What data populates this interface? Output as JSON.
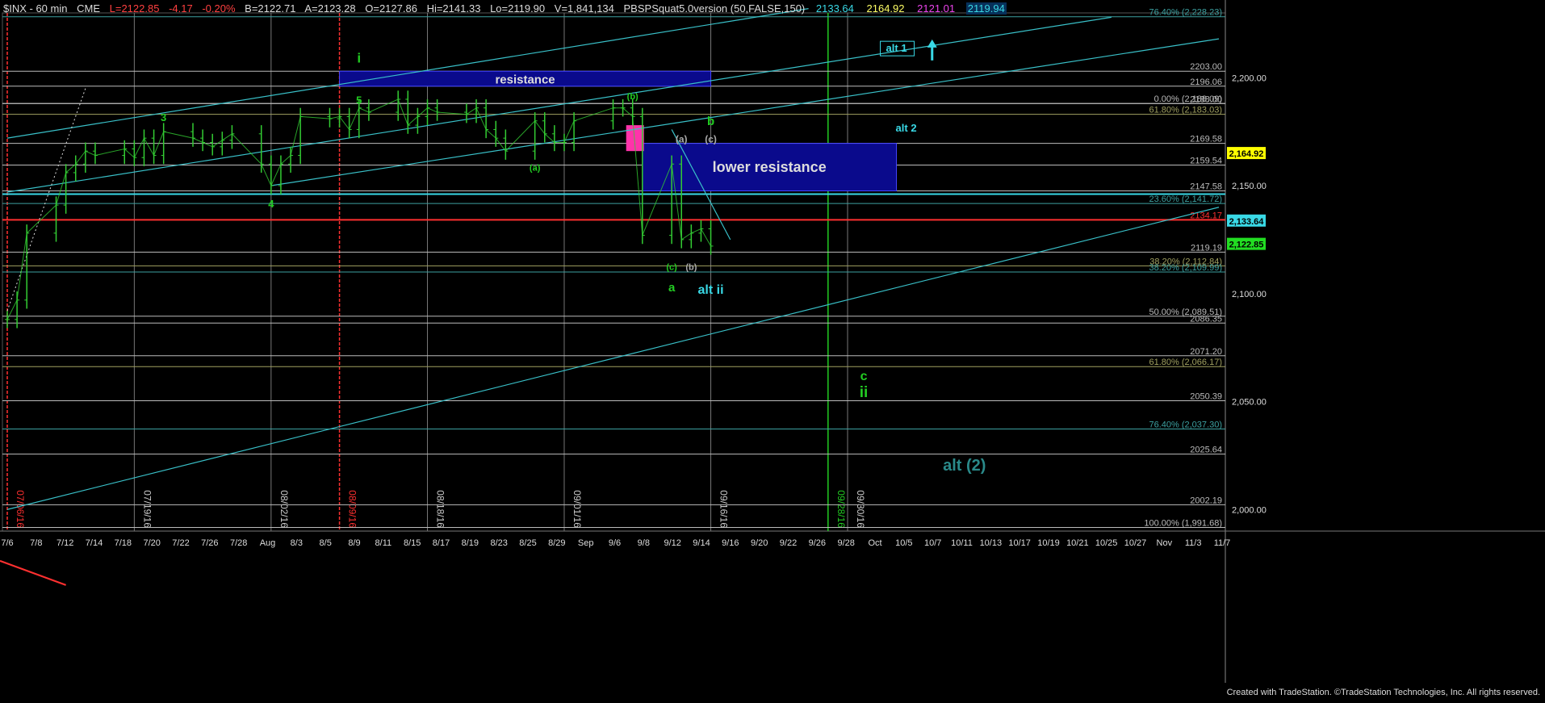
{
  "header": {
    "symbol": "$INX - 60 min",
    "exchange": "CME",
    "last": "L=2122.85",
    "change": "-4.17",
    "change_pct": "-0.20%",
    "bid": "B=2122.71",
    "ask": "A=2123.28",
    "open": "O=2127.86",
    "high": "Hi=2141.33",
    "low": "Lo=2119.90",
    "volume": "V=1,841,134",
    "study": "PBSPSquat5.0version (50,FALSE,150)",
    "study_values": [
      {
        "text": "2133.64",
        "color": "#39d9e6"
      },
      {
        "text": "2164.92",
        "color": "#ffff66"
      },
      {
        "text": "2121.01",
        "color": "#ee44ee"
      },
      {
        "text": "2119.94",
        "color": "#39d9e6"
      }
    ]
  },
  "footer": "Created with TradeStation. ©TradeStation Technologies, Inc. All rights reserved.",
  "chart_data": {
    "type": "line",
    "title": "",
    "ylim": [
      1990,
      2230
    ],
    "y_axis_ticks": [
      "2,200.00",
      "2,150.00",
      "2,100.00",
      "2,050.00",
      "2,000.00"
    ],
    "x_axis_labels": [
      "7/6",
      "7/8",
      "7/12",
      "7/14",
      "7/18",
      "7/20",
      "7/22",
      "7/26",
      "7/28",
      "Aug",
      "8/3",
      "8/5",
      "8/9",
      "8/11",
      "8/15",
      "8/17",
      "8/19",
      "8/23",
      "8/25",
      "8/29",
      "Sep",
      "9/6",
      "9/8",
      "9/12",
      "9/14",
      "9/16",
      "9/20",
      "9/22",
      "9/26",
      "9/28",
      "Oct",
      "10/5",
      "10/7",
      "10/11",
      "10/13",
      "10/17",
      "10/19",
      "10/21",
      "10/25",
      "10/27",
      "Nov",
      "11/3",
      "11/7"
    ],
    "vertical_date_labels": [
      {
        "text": "07/06/16",
        "color": "#ff3030"
      },
      {
        "text": "07/19/16",
        "color": "#cccccc"
      },
      {
        "text": "08/02/16",
        "color": "#cccccc"
      },
      {
        "text": "08/09/16",
        "color": "#ff3030"
      },
      {
        "text": "08/18/16",
        "color": "#cccccc"
      },
      {
        "text": "09/01/16",
        "color": "#cccccc"
      },
      {
        "text": "09/16/16",
        "color": "#cccccc"
      },
      {
        "text": "09/28/16",
        "color": "#22cc22"
      },
      {
        "text": "09/30/16",
        "color": "#cccccc"
      }
    ],
    "levels": [
      {
        "label": "76.40% (2,228.23)",
        "value": 2228.23,
        "color": "#3ca0a0"
      },
      {
        "label": "2203.00",
        "value": 2203.0,
        "color": "#bbbbbb"
      },
      {
        "label": "2196.06",
        "value": 2196.06,
        "color": "#bbbbbb"
      },
      {
        "label": "0.00% (2,188.09)",
        "value": 2188.09,
        "color": "#bbbbbb"
      },
      {
        "label": "2188.00",
        "value": 2188.0,
        "color": "#bbbbbb"
      },
      {
        "label": "61.80% (2,183.03)",
        "value": 2183.03,
        "color": "#a0a060"
      },
      {
        "label": "2169.58",
        "value": 2169.58,
        "color": "#bbbbbb"
      },
      {
        "label": "2159.54",
        "value": 2159.54,
        "color": "#bbbbbb"
      },
      {
        "label": "2147.58",
        "value": 2147.58,
        "color": "#bbbbbb"
      },
      {
        "label": "23.60% (2,141.72)",
        "value": 2141.72,
        "color": "#3ca0a0"
      },
      {
        "label": "2134.17",
        "value": 2134.17,
        "color": "#ff3030"
      },
      {
        "label": "2119.19",
        "value": 2119.19,
        "color": "#bbbbbb"
      },
      {
        "label": "38.20% (2,112.84)",
        "value": 2112.84,
        "color": "#a0a060"
      },
      {
        "label": "38.20% (2,109.99)",
        "value": 2109.99,
        "color": "#3ca0a0"
      },
      {
        "label": "50.00% (2,089.51)",
        "value": 2089.51,
        "color": "#bbbbbb"
      },
      {
        "label": "2086.35",
        "value": 2086.35,
        "color": "#bbbbbb"
      },
      {
        "label": "2071.20",
        "value": 2071.2,
        "color": "#bbbbbb"
      },
      {
        "label": "61.80% (2,066.17)",
        "value": 2066.17,
        "color": "#a0a060"
      },
      {
        "label": "2050.39",
        "value": 2050.39,
        "color": "#bbbbbb"
      },
      {
        "label": "76.40% (2,037.30)",
        "value": 2037.3,
        "color": "#3ca0a0"
      },
      {
        "label": "2025.64",
        "value": 2025.64,
        "color": "#bbbbbb"
      },
      {
        "label": "2002.19",
        "value": 2002.19,
        "color": "#bbbbbb"
      },
      {
        "label": "100.00% (1,991.68)",
        "value": 1991.68,
        "color": "#bbbbbb"
      }
    ],
    "price_tags": [
      {
        "text": "2,164.92",
        "value": 2164.92,
        "bg": "#ffff00",
        "fg": "#000000"
      },
      {
        "text": "2,133.64",
        "value": 2133.64,
        "bg": "#39d9e6",
        "fg": "#000000"
      },
      {
        "text": "2,122.85",
        "value": 2122.85,
        "bg": "#22dd22",
        "fg": "#000000"
      }
    ],
    "zones": [
      {
        "label": "resistance",
        "top": 2203.0,
        "bottom": 2196.06,
        "x_start": "8/9",
        "x_end": "9/16"
      },
      {
        "label": "lower resistance",
        "top": 2169.58,
        "bottom": 2147.58,
        "x_start": "9/9",
        "x_end": "10/5"
      }
    ],
    "wave_labels": [
      {
        "text": "i",
        "color": "#22cc22"
      },
      {
        "text": "5",
        "color": "#22cc22"
      },
      {
        "text": "3",
        "color": "#22cc22"
      },
      {
        "text": "4",
        "color": "#22cc22"
      },
      {
        "text": "(a)",
        "color": "#22cc22"
      },
      {
        "text": "(b)",
        "color": "#22cc22"
      },
      {
        "text": "(c)",
        "color": "#22cc22"
      },
      {
        "text": "a",
        "color": "#22cc22"
      },
      {
        "text": "b",
        "color": "#22cc22"
      },
      {
        "text": "(a)",
        "color": "#aaaaaa"
      },
      {
        "text": "(b)",
        "color": "#aaaaaa"
      },
      {
        "text": "(c)",
        "color": "#aaaaaa"
      },
      {
        "text": "alt ii",
        "color": "#39d9e6"
      },
      {
        "text": "alt 1",
        "color": "#39d9e6"
      },
      {
        "text": "alt 2",
        "color": "#39d9e6"
      },
      {
        "text": "c",
        "color": "#22cc22"
      },
      {
        "text": "ii",
        "color": "#22cc22"
      },
      {
        "text": "alt (2)",
        "color": "#2a8a8a"
      }
    ],
    "series": [
      {
        "type": "bar-ohlc",
        "color": "#33cc33",
        "points": [
          [
            "7/6",
            2088
          ],
          [
            "7/7",
            2097
          ],
          [
            "7/8",
            2128
          ],
          [
            "7/11",
            2141
          ],
          [
            "7/12",
            2156
          ],
          [
            "7/13",
            2160
          ],
          [
            "7/14",
            2166
          ],
          [
            "7/15",
            2164
          ],
          [
            "7/18",
            2167
          ],
          [
            "7/19",
            2163
          ],
          [
            "7/20",
            2172
          ],
          [
            "7/21",
            2164
          ],
          [
            "7/22",
            2175
          ],
          [
            "7/25",
            2172
          ],
          [
            "7/26",
            2170
          ],
          [
            "7/27",
            2168
          ],
          [
            "7/28",
            2171
          ],
          [
            "7/29",
            2174
          ],
          [
            "8/1",
            2160
          ],
          [
            "8/2",
            2150
          ],
          [
            "8/3",
            2160
          ],
          [
            "8/4",
            2164
          ],
          [
            "8/5",
            2182
          ],
          [
            "8/8",
            2181
          ],
          [
            "8/9",
            2182
          ],
          [
            "8/10",
            2176
          ],
          [
            "8/11",
            2186
          ],
          [
            "8/12",
            2184
          ],
          [
            "8/15",
            2190
          ],
          [
            "8/16",
            2178
          ],
          [
            "8/17",
            2182
          ],
          [
            "8/18",
            2186
          ],
          [
            "8/19",
            2184
          ],
          [
            "8/22",
            2183
          ],
          [
            "8/23",
            2186
          ],
          [
            "8/24",
            2176
          ],
          [
            "8/25",
            2172
          ],
          [
            "8/26",
            2166
          ],
          [
            "8/29",
            2180
          ],
          [
            "8/30",
            2174
          ],
          [
            "8/31",
            2170
          ],
          [
            "9/1",
            2170
          ],
          [
            "9/2",
            2180
          ],
          [
            "9/6",
            2186
          ],
          [
            "9/7",
            2186
          ],
          [
            "9/8",
            2182
          ],
          [
            "9/9",
            2127
          ],
          [
            "9/12",
            2160
          ],
          [
            "9/13",
            2125
          ],
          [
            "9/14",
            2128
          ],
          [
            "9/15",
            2130
          ],
          [
            "9/16",
            2122
          ]
        ]
      }
    ]
  }
}
